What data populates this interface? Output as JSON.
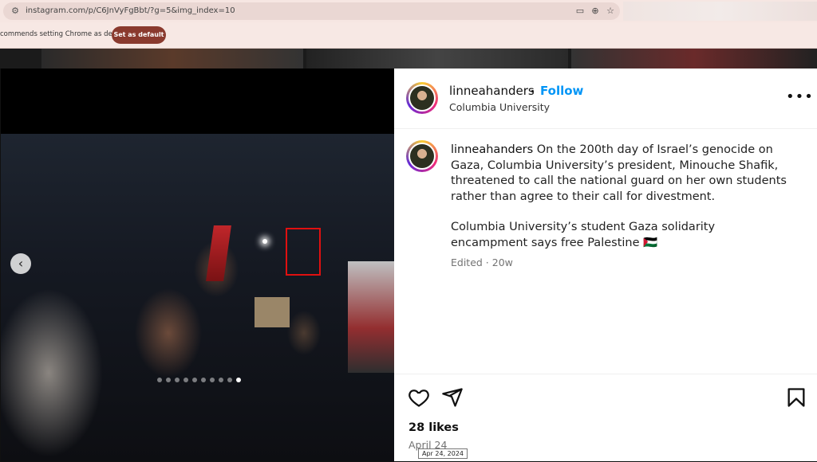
{
  "browser": {
    "url": "instagram.com/p/C6JnVyFgBbt/?g=5&img_index=10",
    "infobar_text": "commends setting Chrome as default",
    "set_default_label": "Set as default"
  },
  "post": {
    "username": "linneahanders",
    "follow_separator": "•",
    "follow_label": "Follow",
    "location": "Columbia University",
    "more_label": "•••",
    "caption_user": "linneahanders",
    "caption_p1": " On the 200th day of Israel’s genocide on Gaza, Columbia University’s president, Minouche Shafik, threatened to call the national guard on her own students rather than agree to their call for divestment.",
    "caption_p2": "Columbia University’s student Gaza solidarity encampment says free Palestine 🇵🇸",
    "edited": "Edited · 20w",
    "likes": "28 likes",
    "date": "April 24",
    "date_tooltip": "Apr 24, 2024"
  },
  "carousel": {
    "prev_label": "‹",
    "dot_count": 10,
    "active_index": 9
  },
  "colors": {
    "follow": "#0095f6",
    "set_default_bg": "#8a3a2e",
    "face_box": "#e01010"
  },
  "icons": [
    "site-info-icon",
    "cast-icon",
    "zoom-icon",
    "star-icon",
    "heart-icon",
    "share-icon",
    "bookmark-icon"
  ]
}
